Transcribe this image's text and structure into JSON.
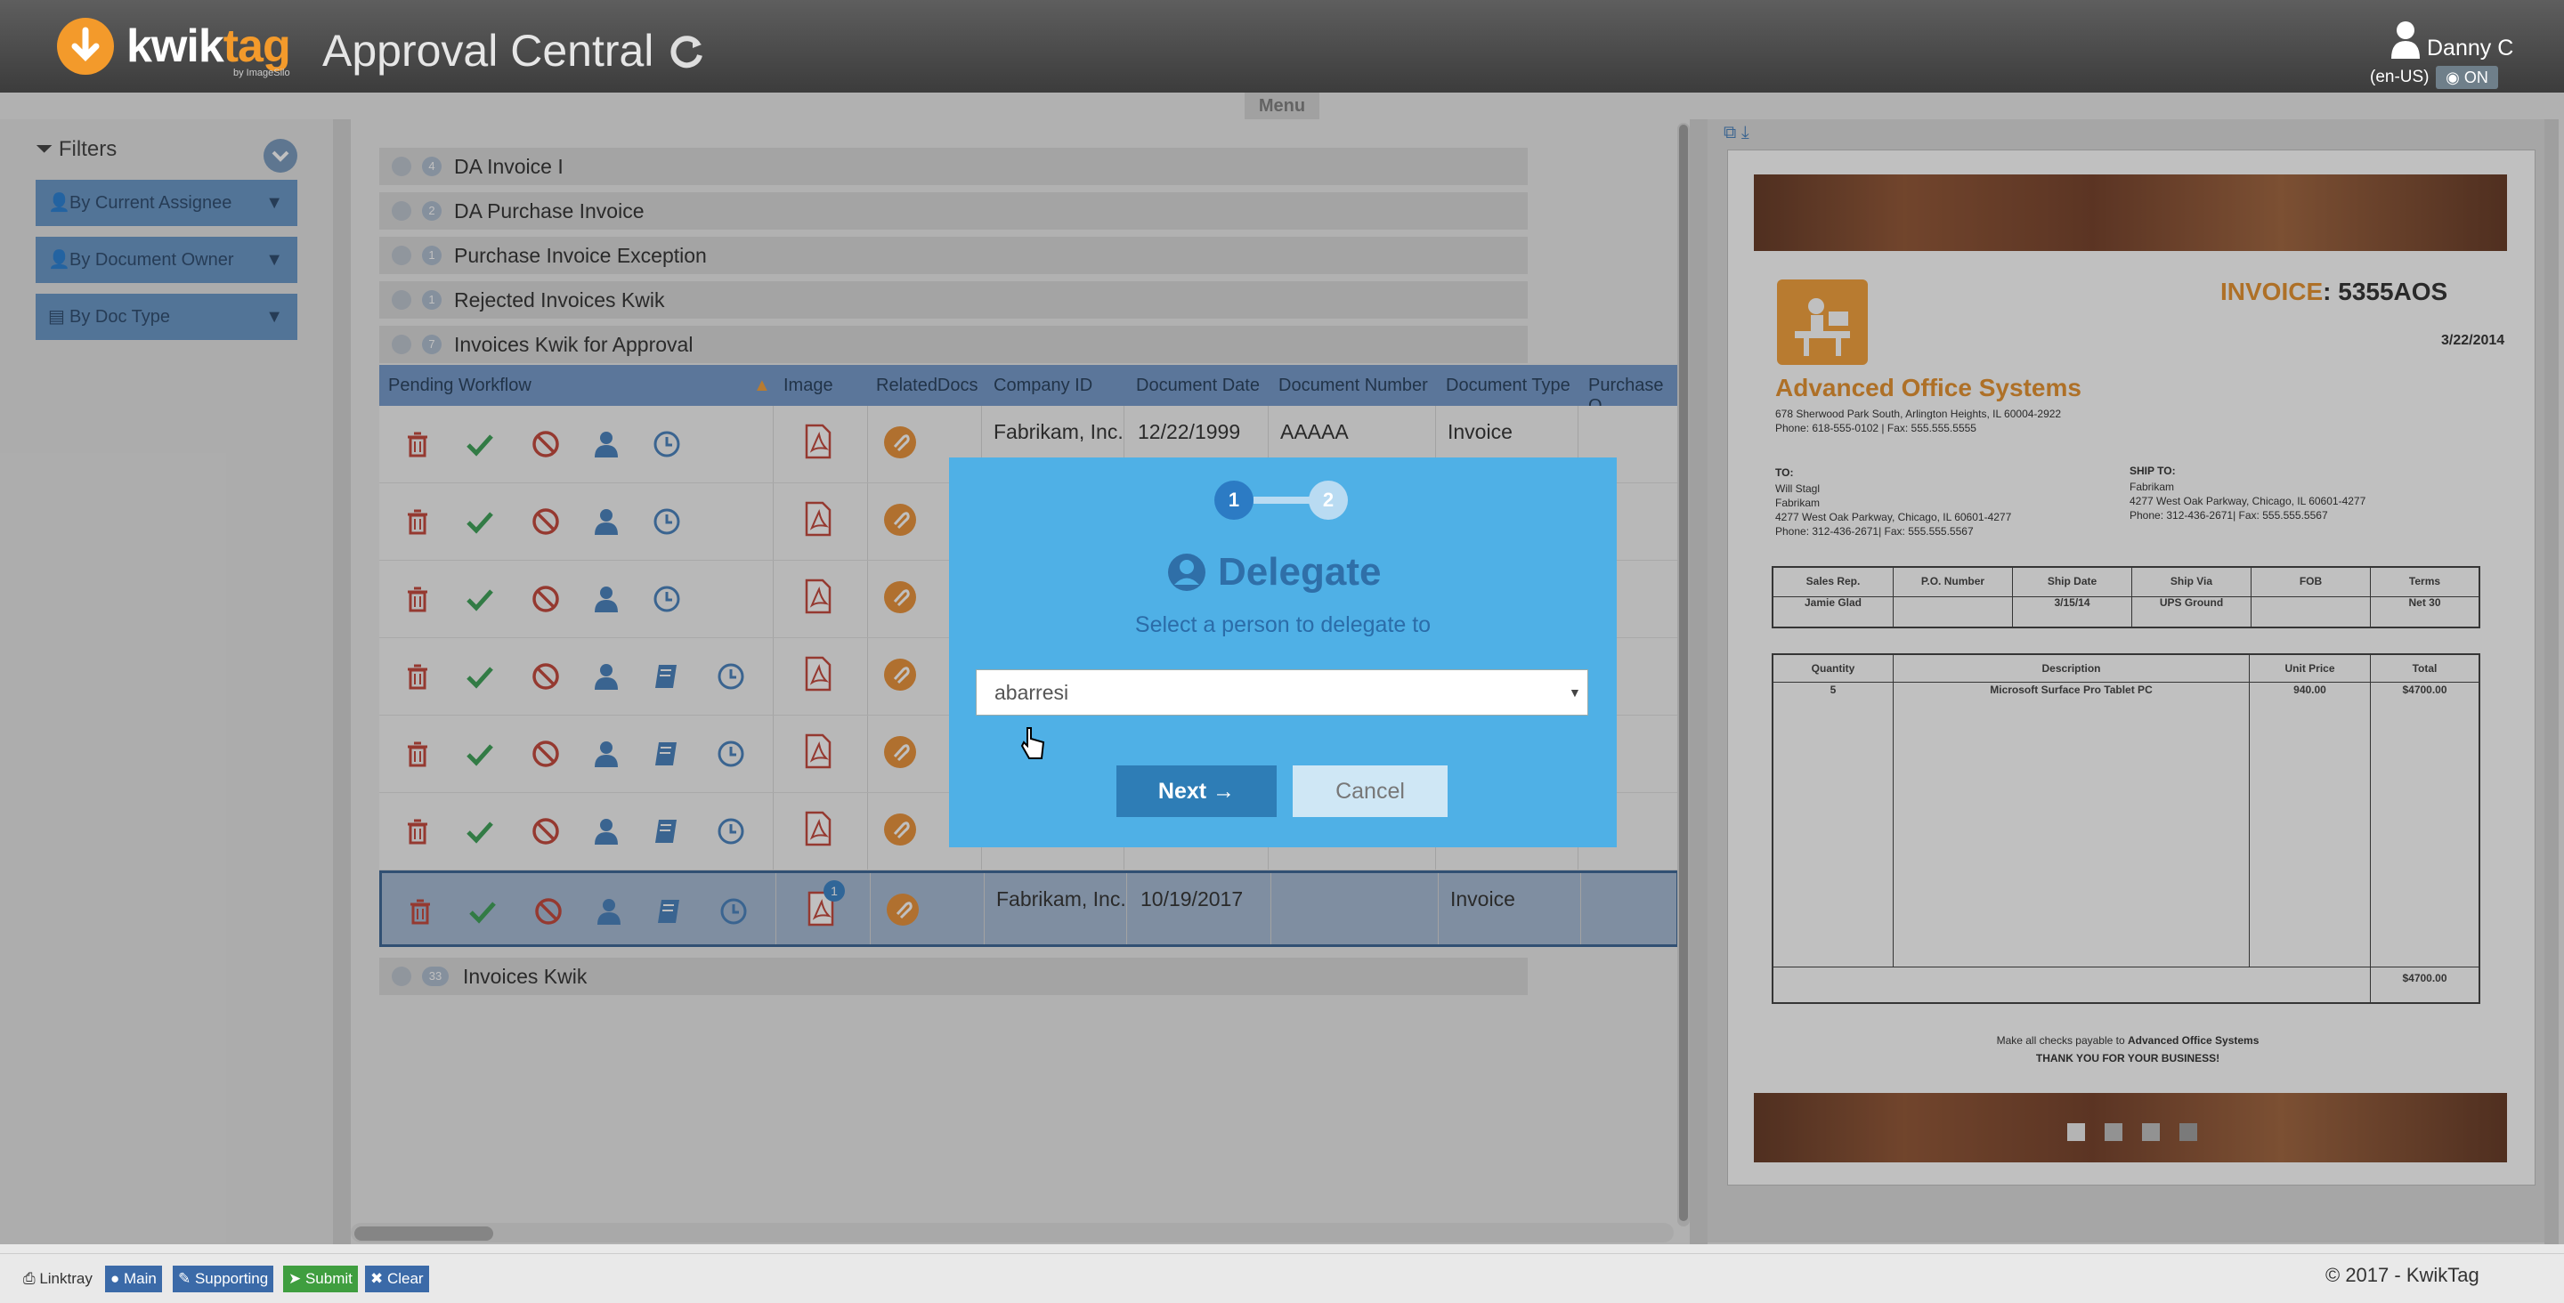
{
  "header": {
    "logo_kwik": "kwik",
    "logo_tag": "tag",
    "logo_sub": "by ImageSilo",
    "title": "Approval Central",
    "user_name": "Danny C",
    "locale": "(en-US)",
    "toggle_label": "ON"
  },
  "menu_label": "Menu",
  "filters": {
    "title": "Filters",
    "items": [
      "By Current Assignee",
      "By Document Owner",
      "By Doc Type"
    ]
  },
  "groups": [
    {
      "count": "4",
      "label": "DA Invoice I"
    },
    {
      "count": "2",
      "label": "DA Purchase Invoice"
    },
    {
      "count": "1",
      "label": "Purchase Invoice Exception"
    },
    {
      "count": "1",
      "label": "Rejected Invoices Kwik"
    },
    {
      "count": "7",
      "label": "Invoices Kwik for Approval"
    }
  ],
  "last_group": {
    "count": "33",
    "label": "Invoices Kwik"
  },
  "grid": {
    "columns": [
      "Pending Workflow",
      "Image",
      "RelatedDocs",
      "Company ID",
      "Document Date",
      "Document Number",
      "Document Type",
      "Purchase O"
    ],
    "rows": [
      {
        "company": "Fabrikam, Inc.",
        "date": "12/22/1999",
        "number": "AAAAA",
        "type": "Invoice"
      },
      {
        "company": "",
        "date": "",
        "number": "",
        "type": ""
      },
      {
        "company": "",
        "date": "",
        "number": "",
        "type": ""
      },
      {
        "company": "",
        "date": "",
        "number": "",
        "type": ""
      },
      {
        "company": "",
        "date": "",
        "number": "",
        "type": ""
      },
      {
        "company": "",
        "date": "",
        "number": "",
        "type": ""
      },
      {
        "company": "Fabrikam, Inc.",
        "date": "10/19/2017",
        "number": "",
        "type": "Invoice",
        "badge": "1"
      }
    ]
  },
  "dialog": {
    "step1": "1",
    "step2": "2",
    "title": "Delegate",
    "subtitle": "Select a person to delegate to",
    "selected_person": "abarresi",
    "next_label": "Next →",
    "cancel_label": "Cancel"
  },
  "invoice": {
    "heading_word": "INVOICE",
    "number": ": 5355AOS",
    "date": "3/22/2014",
    "company": "Advanced Office Systems",
    "address": "678 Sherwood Park South, Arlington Heights, IL 60004-2922",
    "phone": "Phone: 618-555-0102  |  Fax: 555.555.5555",
    "to_label": "TO:",
    "to_lines": [
      "Will Stagl",
      "Fabrikam",
      "4277 West Oak Parkway, Chicago, IL 60601-4277",
      "Phone: 312-436-2671|  Fax: 555.555.5567"
    ],
    "ship_label": "SHIP TO:",
    "ship_lines": [
      "Fabrikam",
      "4277 West Oak Parkway, Chicago, IL 60601-4277",
      "Phone: 312-436-2671|  Fax: 555.555.5567"
    ],
    "info_headers": [
      "Sales Rep.",
      "P.O. Number",
      "Ship Date",
      "Ship Via",
      "FOB",
      "Terms"
    ],
    "info_values": [
      "Jamie Glad",
      "",
      "3/15/14",
      "UPS Ground",
      "",
      "Net 30"
    ],
    "item_headers": [
      "Quantity",
      "Description",
      "Unit Price",
      "Total"
    ],
    "item_values": [
      "5",
      "Microsoft Surface Pro Tablet PC",
      "940.00",
      "$4700.00"
    ],
    "grand_total": "$4700.00",
    "footer_line1": "Make all checks payable to",
    "footer_company": "Advanced Office Systems",
    "footer_line2": "THANK YOU FOR YOUR BUSINESS!"
  },
  "footer": {
    "buttons": [
      "Linktray",
      "Main",
      "Supporting",
      "Submit",
      "Clear"
    ],
    "copyright": "© 2017 - KwikTag"
  },
  "colors": {
    "accent": "#f39a2b",
    "header": "#4a4a4a",
    "modal": "#4fb0e6",
    "grid_header": "#6b93c7"
  }
}
